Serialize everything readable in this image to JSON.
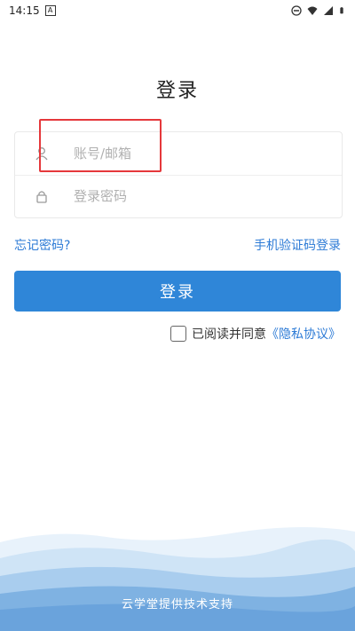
{
  "status_bar": {
    "time": "14:15",
    "icons": [
      "notification-a-icon",
      "dnd-icon",
      "wifi-icon",
      "signal-icon",
      "battery-icon"
    ]
  },
  "login": {
    "title": "登录",
    "username_placeholder": "账号/邮箱",
    "password_placeholder": "登录密码",
    "forgot_password": "忘记密码?",
    "sms_login": "手机验证码登录",
    "login_button": "登录",
    "agreement_text": "已阅读并同意",
    "privacy_policy": "《隐私协议》"
  },
  "footer": {
    "support_text": "云学堂提供技术支持"
  },
  "colors": {
    "primary": "#2f86d8",
    "link": "#2d7bd6",
    "highlight": "#e5383b"
  }
}
